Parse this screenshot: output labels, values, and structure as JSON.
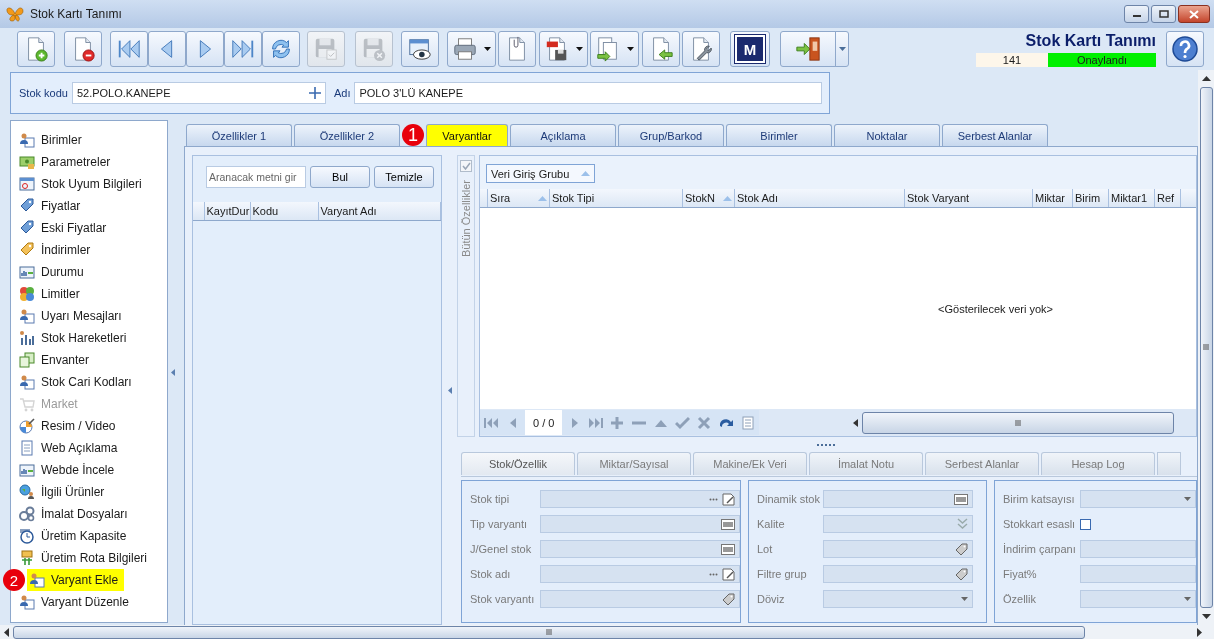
{
  "window": {
    "title": "Stok Kartı Tanımı"
  },
  "toolbar": [
    {
      "kind": "new",
      "disabled": false
    },
    {
      "kind": "delete",
      "disabled": false
    },
    {
      "kind": "first",
      "disabled": false
    },
    {
      "kind": "prev",
      "disabled": false
    },
    {
      "kind": "next",
      "disabled": false
    },
    {
      "kind": "last",
      "disabled": false
    },
    {
      "kind": "refresh",
      "disabled": false
    },
    {
      "kind": "save",
      "disabled": true
    },
    {
      "kind": "cancel",
      "disabled": true
    },
    {
      "kind": "preview",
      "disabled": false
    },
    {
      "kind": "print",
      "disabled": false,
      "has_menu": true
    },
    {
      "kind": "attach",
      "disabled": false
    },
    {
      "kind": "pdf",
      "disabled": false,
      "has_menu": true
    },
    {
      "kind": "copy",
      "disabled": false,
      "has_menu": true
    },
    {
      "kind": "import",
      "disabled": false
    },
    {
      "kind": "tools",
      "disabled": false
    },
    {
      "kind": "logo",
      "disabled": false,
      "label": "M"
    },
    {
      "kind": "exit",
      "disabled": false,
      "has_menu": true
    }
  ],
  "header": {
    "title": "Stok Kartı Tanımı",
    "record_no": "141",
    "status": "Onaylandı"
  },
  "form": {
    "stock_code": {
      "label": "Stok kodu",
      "value": "52.POLO.KANEPE"
    },
    "name": {
      "label": "Adı",
      "value": "POLO 3'LÜ KANEPE"
    }
  },
  "sidebar": {
    "items": [
      {
        "label": "Birimler",
        "disabled": false,
        "highlighted": false
      },
      {
        "label": "Parametreler",
        "disabled": false,
        "highlighted": false
      },
      {
        "label": "Stok Uyum Bilgileri",
        "disabled": false,
        "highlighted": false
      },
      {
        "label": "Fiyatlar",
        "disabled": false,
        "highlighted": false
      },
      {
        "label": "Eski Fiyatlar",
        "disabled": false,
        "highlighted": false
      },
      {
        "label": "İndirimler",
        "disabled": false,
        "highlighted": false
      },
      {
        "label": "Durumu",
        "disabled": false,
        "highlighted": false
      },
      {
        "label": "Limitler",
        "disabled": false,
        "highlighted": false
      },
      {
        "label": "Uyarı Mesajları",
        "disabled": false,
        "highlighted": false
      },
      {
        "label": "Stok Hareketleri",
        "disabled": false,
        "highlighted": false
      },
      {
        "label": "Envanter",
        "disabled": false,
        "highlighted": false
      },
      {
        "label": "Stok Cari Kodları",
        "disabled": false,
        "highlighted": false
      },
      {
        "label": "Market",
        "disabled": true,
        "highlighted": false
      },
      {
        "label": "Resim / Video",
        "disabled": false,
        "highlighted": false
      },
      {
        "label": "Web Açıklama",
        "disabled": false,
        "highlighted": false
      },
      {
        "label": "Webde İncele",
        "disabled": false,
        "highlighted": false
      },
      {
        "label": "İlgili Ürünler",
        "disabled": false,
        "highlighted": false
      },
      {
        "label": "İmalat Dosyaları",
        "disabled": false,
        "highlighted": false
      },
      {
        "label": "Üretim Kapasite",
        "disabled": false,
        "highlighted": false
      },
      {
        "label": "Üretim Rota Bilgileri",
        "disabled": false,
        "highlighted": false
      },
      {
        "label": "Varyant Ekle",
        "disabled": false,
        "highlighted": true,
        "annotation": "2"
      },
      {
        "label": "Varyant Düzenle",
        "disabled": false,
        "highlighted": false
      }
    ]
  },
  "tabs": [
    {
      "label": "Özellikler 1",
      "selected": false,
      "highlighted": false
    },
    {
      "label": "Özellikler 2",
      "selected": false,
      "highlighted": false
    },
    {
      "label": "Varyantlar",
      "selected": true,
      "highlighted": true,
      "annotation": "1"
    },
    {
      "label": "Açıklama",
      "selected": false,
      "highlighted": false
    },
    {
      "label": "Grup/Barkod",
      "selected": false,
      "highlighted": false
    },
    {
      "label": "Birimler",
      "selected": false,
      "highlighted": false
    },
    {
      "label": "Noktalar",
      "selected": false,
      "highlighted": false
    },
    {
      "label": "Serbest Alanlar",
      "selected": false,
      "highlighted": false
    }
  ],
  "variant_list": {
    "search": {
      "placeholder": "Aranacak metni gir"
    },
    "buttons": [
      "Bul",
      "Temizle"
    ],
    "columns": [
      "KayıtDur",
      "Kodu",
      "Varyant Adı"
    ]
  },
  "properties_strip": {
    "label": "Bütün Özellikler",
    "checked": true
  },
  "grid": {
    "group_by": "Veri Giriş Grubu",
    "columns": [
      {
        "label": "Sıra",
        "sorted": true
      },
      {
        "label": "Stok Tipi",
        "sorted": false
      },
      {
        "label": "StokN",
        "sorted": true
      },
      {
        "label": "Stok Adı",
        "sorted": false
      },
      {
        "label": "Stok Varyant",
        "sorted": false
      },
      {
        "label": "Miktar",
        "sorted": false
      },
      {
        "label": "Birim",
        "sorted": false
      },
      {
        "label": "Miktar1",
        "sorted": false
      },
      {
        "label": "Ref",
        "sorted": false
      }
    ],
    "empty_text": "<Gösterilecek veri yok>",
    "pager": "0 / 0"
  },
  "bottom_tabs": [
    {
      "label": "Stok/Özellik",
      "selected": true
    },
    {
      "label": "Miktar/Sayısal",
      "selected": false
    },
    {
      "label": "Makine/Ek Veri",
      "selected": false
    },
    {
      "label": "İmalat Notu",
      "selected": false
    },
    {
      "label": "Serbest Alanlar",
      "selected": false
    },
    {
      "label": "Hesap Log",
      "selected": false
    }
  ],
  "bottom_panels": [
    {
      "fields": [
        {
          "label": "Stok tipi",
          "kind": "lookup"
        },
        {
          "label": "Tip varyantı",
          "kind": "barcode"
        },
        {
          "label": "J/Genel stok",
          "kind": "barcode"
        },
        {
          "label": "Stok adı",
          "kind": "lookup"
        },
        {
          "label": "Stok varyantı",
          "kind": "tag"
        }
      ]
    },
    {
      "fields": [
        {
          "label": "Dinamik stok",
          "kind": "barcode"
        },
        {
          "label": "Kalite",
          "kind": "check"
        },
        {
          "label": "Lot",
          "kind": "tag"
        },
        {
          "label": "Filtre grup",
          "kind": "tag"
        },
        {
          "label": "Döviz",
          "kind": "dropdown"
        }
      ]
    },
    {
      "fields": [
        {
          "label": "Birim katsayısı",
          "kind": "dropdown"
        },
        {
          "label": "Stokkart esaslı",
          "kind": "checkbox",
          "checked": false
        },
        {
          "label": "İndirim çarpanı",
          "kind": "plain"
        },
        {
          "label": "Fiyat%",
          "kind": "plain"
        },
        {
          "label": "Özellik",
          "kind": "dropdown"
        }
      ]
    }
  ]
}
